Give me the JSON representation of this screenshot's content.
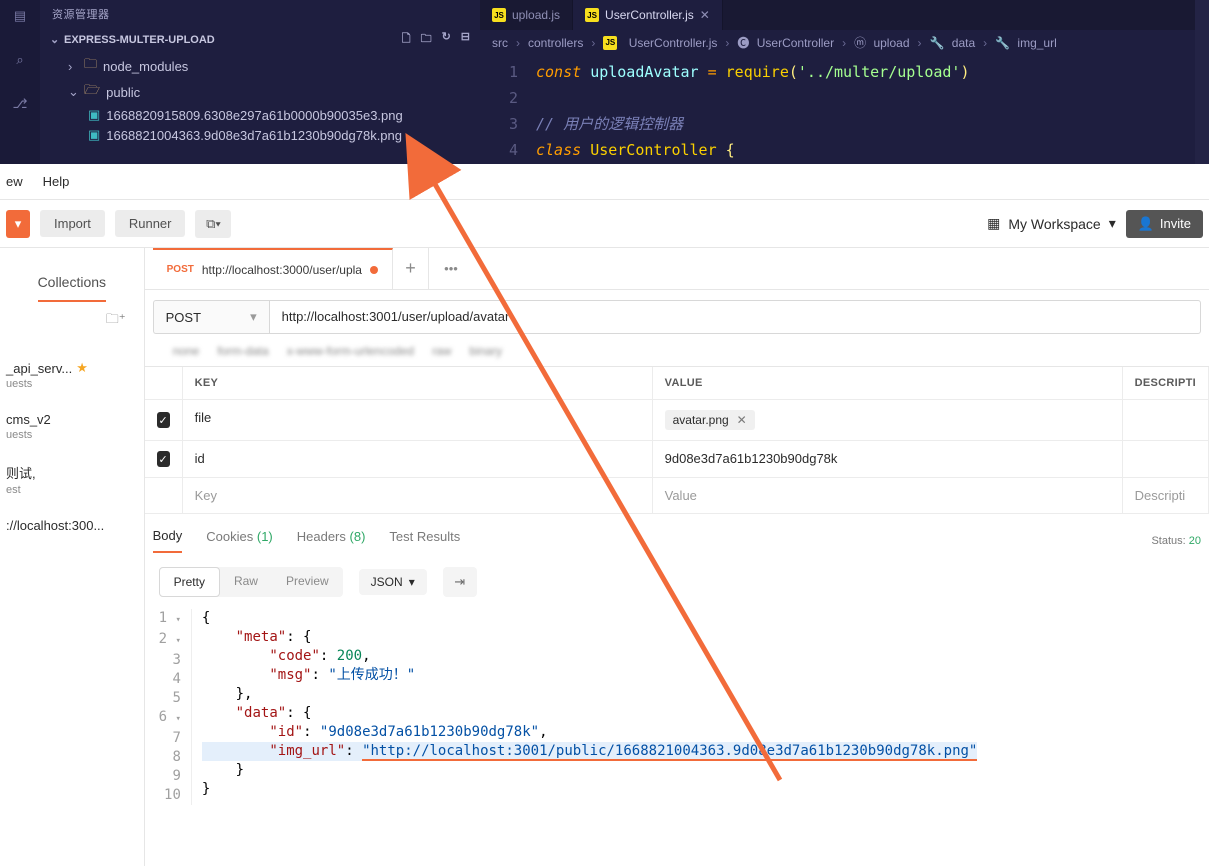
{
  "vscode": {
    "explorerTitle": "资源管理器",
    "project": "EXPRESS-MULTER-UPLOAD",
    "tree": {
      "node_modules": "node_modules",
      "public": "public",
      "file1": "1668820915809.6308e297a61b0000b90035e3.png",
      "file2": "1668821004363.9d08e3d7a61b1230b90dg78k.png"
    },
    "tabs": {
      "upload": "upload.js",
      "controller": "UserController.js"
    },
    "breadcrumbs": {
      "src": "src",
      "controllers": "controllers",
      "file": "UserController.js",
      "cls": "UserController",
      "method": "upload",
      "data": "data",
      "img_url": "img_url"
    },
    "code": {
      "l1": {
        "const": "const ",
        "name": "uploadAvatar ",
        "eq": "= ",
        "req": "require",
        "lp": "(",
        "str": "'../multer/upload'",
        "rp": ")"
      },
      "l3": "// 用户的逻辑控制器",
      "l4": {
        "cls": "class ",
        "name": "UserController ",
        "brc": "{"
      }
    }
  },
  "postman": {
    "menu": {
      "view": "ew",
      "help": "Help"
    },
    "toolbar": {
      "import": "Import",
      "runner": "Runner",
      "workspace": "My Workspace",
      "invite": "Invite"
    },
    "sidebar": {
      "tab": "Collections",
      "items": [
        {
          "title": "_api_serv...",
          "sub": "uests",
          "star": true
        },
        {
          "title": "cms_v2",
          "sub": "uests",
          "star": false
        },
        {
          "title": "则试,",
          "sub": "est",
          "star": false
        },
        {
          "title": "://localhost:300...",
          "sub": "",
          "star": false
        }
      ]
    },
    "request": {
      "tab": {
        "method": "POST",
        "label": "http://localhost:3000/user/upla"
      },
      "method": "POST",
      "url": "http://localhost:3001/user/upload/avatar",
      "bodyTypes": [
        "none",
        "form-data",
        "x-www-form-urlencoded",
        "raw",
        "binary"
      ],
      "table": {
        "headers": {
          "key": "KEY",
          "value": "VALUE",
          "desc": "DESCRIPTI"
        },
        "rows": [
          {
            "key": "file",
            "value": "avatar.png",
            "isFile": true
          },
          {
            "key": "id",
            "value": "9d08e3d7a61b1230b90dg78k",
            "isFile": false
          }
        ],
        "placeholder": {
          "key": "Key",
          "value": "Value",
          "desc": "Descripti"
        }
      }
    },
    "response": {
      "tabs": {
        "body": "Body",
        "cookies": "Cookies",
        "cookiesCount": "(1)",
        "headers": "Headers",
        "headersCount": "(8)",
        "tests": "Test Results"
      },
      "statusLabel": "Status:",
      "statusCode": "20",
      "view": {
        "pretty": "Pretty",
        "raw": "Raw",
        "preview": "Preview",
        "format": "JSON"
      },
      "json": {
        "l1": "{",
        "l2": "    \"meta\": {",
        "l3": "        \"code\": 200,",
        "l4": "        \"msg\": \"上传成功！\"",
        "l5": "    },",
        "l6": "    \"data\": {",
        "l7": "        \"id\": \"9d08e3d7a61b1230b90dg78k\",",
        "l8a": "        \"img_url\": ",
        "l8b": "\"http://localhost:3001/public/1668821004363.9d08e3d7a61b1230b90dg78k.png\"",
        "l9": "    }",
        "l10": "}"
      }
    }
  }
}
